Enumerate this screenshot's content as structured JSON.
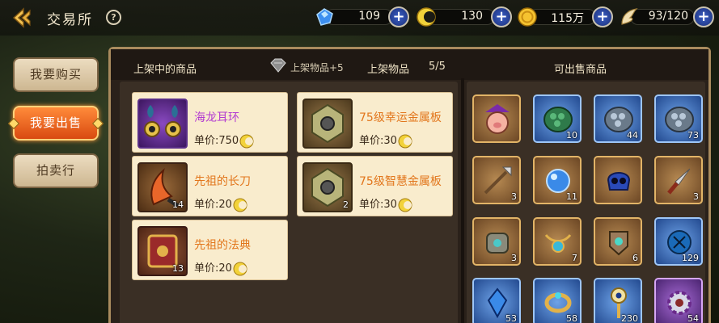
{
  "header": {
    "title": "交易所",
    "help_label": "?"
  },
  "resources": [
    {
      "name": "diamond",
      "icon": "blue-crystal-icon",
      "value": "109"
    },
    {
      "name": "gold-crescent",
      "icon": "crescent-coin-icon",
      "value": "130"
    },
    {
      "name": "gold",
      "icon": "gold-coin-icon",
      "value": "115万"
    },
    {
      "name": "stamina",
      "icon": "wing-icon",
      "value": "93/120"
    }
  ],
  "tabs": [
    {
      "label": "我要购买",
      "active": false
    },
    {
      "label": "我要出售",
      "active": true
    },
    {
      "label": "拍卖行",
      "active": false
    }
  ],
  "panel": {
    "left_title": "上架中的商品",
    "vip_label": "上架物品+5",
    "count_label": "上架物品",
    "count_value": "5/5",
    "right_title": "可出售商品"
  },
  "listings": [
    {
      "name": "海龙耳环",
      "price_label": "单价:",
      "price": "750",
      "qty": "",
      "name_color": "#b23bd1",
      "thumb": "purple"
    },
    {
      "name": "75级幸运金属板",
      "price_label": "单价:",
      "price": "30",
      "qty": "",
      "name_color": "#e2761c",
      "thumb": "brown"
    },
    {
      "name": "先祖的长刀",
      "price_label": "单价:",
      "price": "20",
      "qty": "14",
      "name_color": "#e2761c",
      "thumb": "brown"
    },
    {
      "name": "75级智慧金属板",
      "price_label": "单价:",
      "price": "30",
      "qty": "2",
      "name_color": "#e2761c",
      "thumb": "brown"
    },
    {
      "name": "先祖的法典",
      "price_label": "单价:",
      "price": "20",
      "qty": "13",
      "name_color": "#e2761c",
      "thumb": "brown"
    }
  ],
  "sellable": [
    {
      "icon": "pig-hat-icon",
      "qty": "",
      "frame": "brown"
    },
    {
      "icon": "green-scales-icon",
      "qty": "10",
      "frame": "blue"
    },
    {
      "icon": "silver-scales-icon",
      "qty": "44",
      "frame": "blue"
    },
    {
      "icon": "silver-scales-icon",
      "qty": "73",
      "frame": "blue"
    },
    {
      "icon": "spear-icon",
      "qty": "3",
      "frame": "brown"
    },
    {
      "icon": "blue-orb-icon",
      "qty": "11",
      "frame": "brown"
    },
    {
      "icon": "blue-skull-icon",
      "qty": "",
      "frame": "brown"
    },
    {
      "icon": "dagger-icon",
      "qty": "3",
      "frame": "brown"
    },
    {
      "icon": "gauntlet-icon",
      "qty": "3",
      "frame": "brown"
    },
    {
      "icon": "amulet-icon",
      "qty": "7",
      "frame": "brown"
    },
    {
      "icon": "gem-shield-icon",
      "qty": "6",
      "frame": "brown"
    },
    {
      "icon": "dark-orb-icon",
      "qty": "129",
      "frame": "blue"
    },
    {
      "icon": "blue-crystal-icon",
      "qty": "53",
      "frame": "blue"
    },
    {
      "icon": "gold-ring-icon",
      "qty": "58",
      "frame": "blue"
    },
    {
      "icon": "eye-staff-icon",
      "qty": "230",
      "frame": "blue"
    },
    {
      "icon": "purple-gear-icon",
      "qty": "54",
      "frame": "purple"
    }
  ]
}
